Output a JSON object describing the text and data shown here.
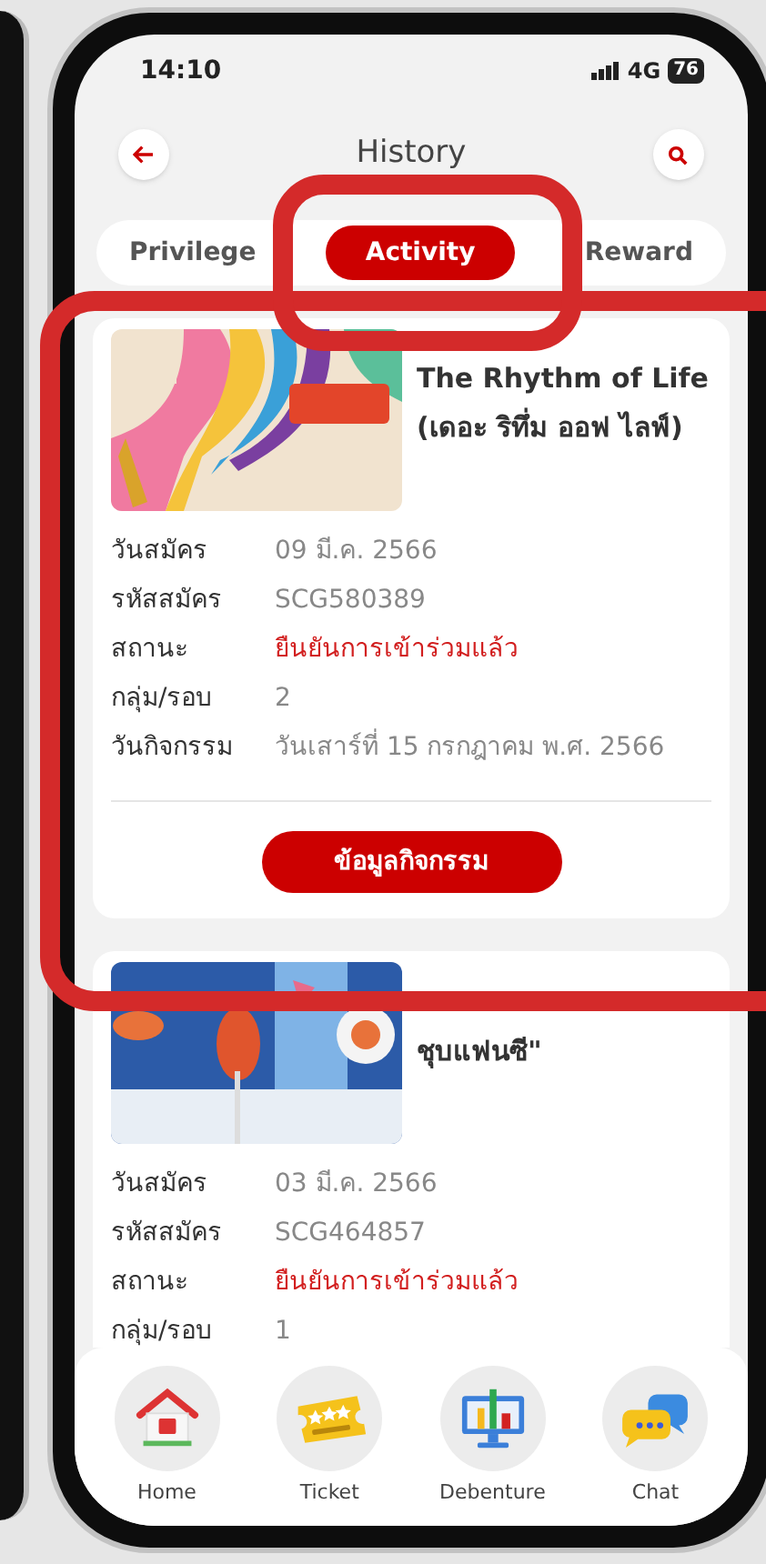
{
  "status_bar": {
    "time": "14:10",
    "network": "4G",
    "battery": "76"
  },
  "header": {
    "title": "History"
  },
  "tabs": [
    {
      "label": "Privilege",
      "selected": false
    },
    {
      "label": "Activity",
      "selected": true
    },
    {
      "label": "Reward",
      "selected": false
    }
  ],
  "activities": [
    {
      "title": "The Rhythm of Life (เดอะ ริทึ่ม ออฟ ไลฟ์)",
      "image": {
        "kind": "picture"
      },
      "fields": [
        {
          "label": "วันสมัคร",
          "value": "09 มี.ค. 2566",
          "kind": "text"
        },
        {
          "label": "รหัสสมัคร",
          "value": "SCG580389",
          "kind": "text"
        },
        {
          "label": "สถานะ",
          "value": "ยืนยันการเข้าร่วมแล้ว",
          "kind": "status"
        },
        {
          "label": "กลุ่ม/รอบ",
          "value": "2",
          "kind": "text"
        },
        {
          "label": "วันกิจกรรม",
          "value": "วันเสาร์ที่ 15 กรกฎาคม พ.ศ. 2566",
          "kind": "text"
        }
      ],
      "button": "ข้อมูลกิจกรรม"
    },
    {
      "title": "ชุบแฟนซี\"",
      "image": {
        "kind": "picture"
      },
      "fields": [
        {
          "label": "วันสมัคร",
          "value": "03 มี.ค. 2566",
          "kind": "text"
        },
        {
          "label": "รหัสสมัคร",
          "value": "SCG464857",
          "kind": "text"
        },
        {
          "label": "สถานะ",
          "value": "ยืนยันการเข้าร่วมแล้ว",
          "kind": "status"
        },
        {
          "label": "กลุ่ม/รอบ",
          "value": "1",
          "kind": "text"
        }
      ]
    }
  ],
  "bottom_nav": [
    {
      "label": "Home",
      "kind": "home"
    },
    {
      "label": "Ticket",
      "kind": "ticket"
    },
    {
      "label": "Debenture",
      "kind": "debenture"
    },
    {
      "label": "Chat",
      "kind": "chat"
    }
  ]
}
